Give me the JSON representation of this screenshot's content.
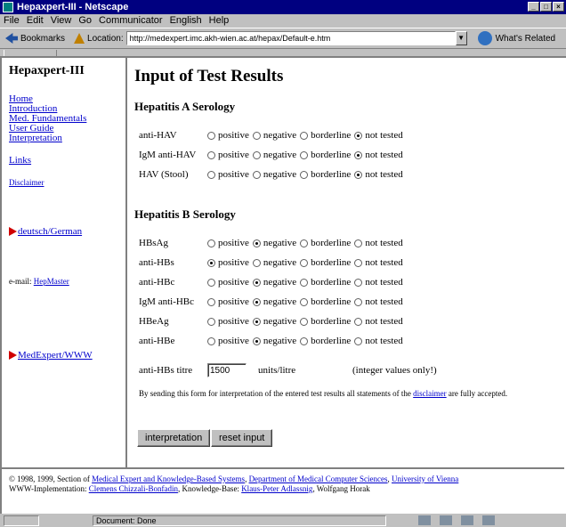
{
  "window": {
    "title": "Hepaxpert-III - Netscape"
  },
  "menu": [
    "File",
    "Edit",
    "View",
    "Go",
    "Communicator",
    "English",
    "Help"
  ],
  "toolbar": {
    "bookmarks": "Bookmarks",
    "location_label": "Location:",
    "url": "http://medexpert.imc.akh-wien.ac.at/hepax/Default-e.htm",
    "whats_related": "What's Related"
  },
  "sidebar": {
    "brand": "Hepaxpert-III",
    "nav": [
      "Home",
      "Introduction",
      "Med. Fundamentals",
      "User Guide",
      "Interpretation"
    ],
    "links": "Links",
    "disclaimer": "Disclaimer",
    "german": "deutsch/German",
    "email_label": "e-mail:",
    "email_link": "HepMaster",
    "medexpert": "MedExpert/WWW"
  },
  "main": {
    "title": "Input of Test Results",
    "section_a": "Hepatitis A Serology",
    "section_b": "Hepatitis B Serology",
    "options": [
      "positive",
      "negative",
      "borderline",
      "not tested"
    ],
    "hav_rows": [
      {
        "label": "anti-HAV",
        "selected": "not tested"
      },
      {
        "label": "IgM anti-HAV",
        "selected": "not tested"
      },
      {
        "label": "HAV (Stool)",
        "selected": "not tested"
      }
    ],
    "hbv_rows": [
      {
        "label": "HBsAg",
        "selected": "negative"
      },
      {
        "label": "anti-HBs",
        "selected": "positive"
      },
      {
        "label": "anti-HBc",
        "selected": "negative"
      },
      {
        "label": "IgM anti-HBc",
        "selected": "negative"
      },
      {
        "label": "HBeAg",
        "selected": "negative"
      },
      {
        "label": "anti-HBe",
        "selected": "negative"
      }
    ],
    "titre": {
      "label": "anti-HBs titre",
      "value": "1500",
      "unit": "units/litre",
      "hint": "(integer values only!)"
    },
    "notice_before": "By sending this form for interpretation of the entered test results all statements of the",
    "notice_link": "disclaimer",
    "notice_after": "are fully accepted.",
    "btn_interpret": "interpretation",
    "btn_reset": "reset input"
  },
  "footer": {
    "line1_prefix": "© 1998, 1999, Section of",
    "link_section": "Medical Expert and Knowledge-Based Systems",
    "link_dept": "Department of Medical Computer Sciences",
    "link_univ": "University of Vienna",
    "line2_prefix": "WWW-Implementation:",
    "link_impl": "Clemens Chizzali-Bonfadin",
    "kb_prefix": "Knowledge-Base:",
    "link_kb": "Klaus-Peter Adlassnig",
    "kb_other": "Wolfgang Horak"
  },
  "status": {
    "text": "Document: Done"
  }
}
